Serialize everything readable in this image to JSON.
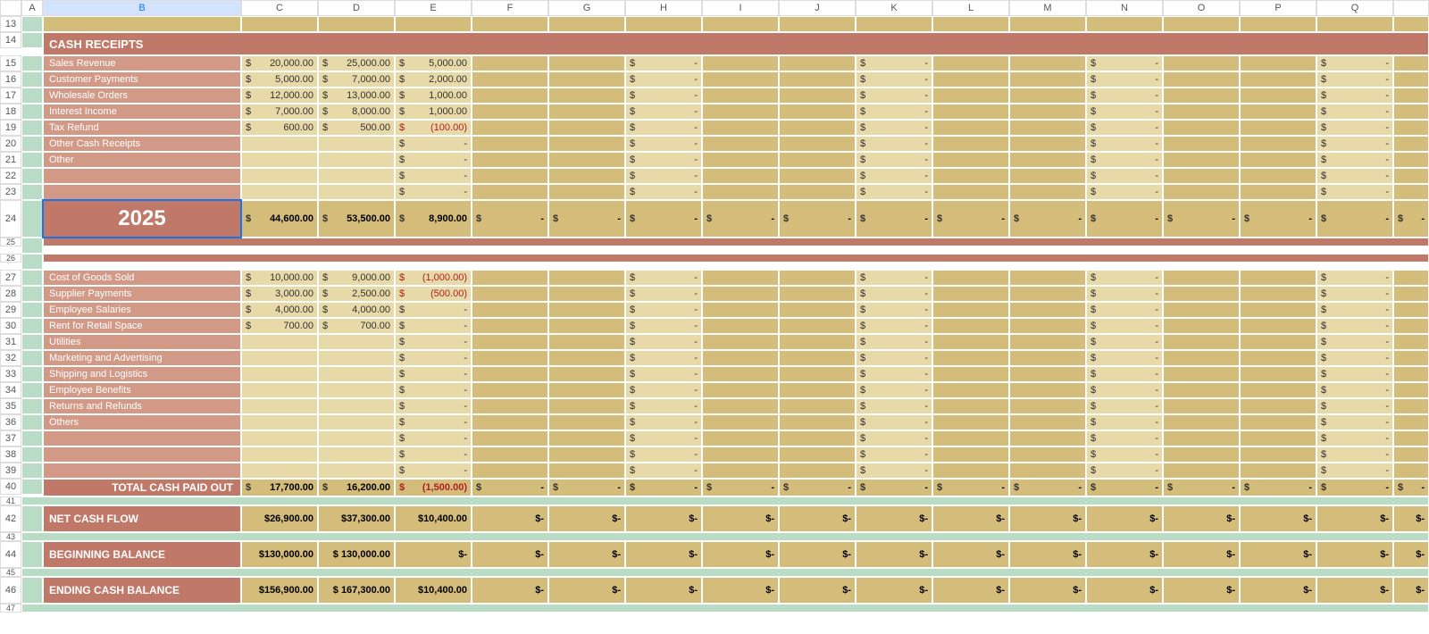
{
  "columns": [
    "",
    "A",
    "B",
    "C",
    "D",
    "E",
    "F",
    "G",
    "H",
    "I",
    "J",
    "K",
    "L",
    "M",
    "N",
    "O",
    "P",
    "Q",
    ""
  ],
  "selected_col": "B",
  "editing_cell_ref": "B11",
  "editing_value": "2025",
  "row_numbers_start": 13,
  "sections": {
    "receipts": {
      "title": "CASH RECEIPTS",
      "rows": [
        {
          "label": "Sales Revenue",
          "vals": [
            "20,000.00",
            "25,000.00",
            "5,000.00"
          ]
        },
        {
          "label": "Customer Payments",
          "vals": [
            "5,000.00",
            "7,000.00",
            "2,000.00"
          ]
        },
        {
          "label": "Wholesale Orders",
          "vals": [
            "12,000.00",
            "13,000.00",
            "1,000.00"
          ]
        },
        {
          "label": "Interest Income",
          "vals": [
            "7,000.00",
            "8,000.00",
            "1,000.00"
          ]
        },
        {
          "label": "Tax Refund",
          "vals": [
            "600.00",
            "500.00",
            "(100.00)"
          ]
        },
        {
          "label": "Other Cash Receipts",
          "vals": [
            "",
            "",
            "-"
          ]
        },
        {
          "label": "Other",
          "vals": [
            "",
            "",
            "-"
          ]
        },
        {
          "label": "",
          "vals": [
            "",
            "",
            "-"
          ]
        },
        {
          "label": "",
          "vals": [
            "",
            "",
            "-"
          ]
        }
      ],
      "total_vals": [
        "44,600.00",
        "53,500.00",
        "8,900.00"
      ]
    },
    "paidout": {
      "rows": [
        {
          "label": "Cost of Goods Sold",
          "vals": [
            "10,000.00",
            "9,000.00",
            "(1,000.00)"
          ]
        },
        {
          "label": "Supplier Payments",
          "vals": [
            "3,000.00",
            "2,500.00",
            "(500.00)"
          ]
        },
        {
          "label": "Employee Salaries",
          "vals": [
            "4,000.00",
            "4,000.00",
            "-"
          ]
        },
        {
          "label": "Rent for Retail Space",
          "vals": [
            "700.00",
            "700.00",
            "-"
          ]
        },
        {
          "label": "Utilities",
          "vals": [
            "",
            "",
            "-"
          ]
        },
        {
          "label": "Marketing and Advertising",
          "vals": [
            "",
            "",
            "-"
          ]
        },
        {
          "label": "Shipping and Logistics",
          "vals": [
            "",
            "",
            "-"
          ]
        },
        {
          "label": "Employee Benefits",
          "vals": [
            "",
            "",
            "-"
          ]
        },
        {
          "label": "Returns and Refunds",
          "vals": [
            "",
            "",
            "-"
          ]
        },
        {
          "label": "Others",
          "vals": [
            "",
            "",
            "-"
          ]
        },
        {
          "label": "",
          "vals": [
            "",
            "",
            "-"
          ]
        },
        {
          "label": "",
          "vals": [
            "",
            "",
            "-"
          ]
        },
        {
          "label": "",
          "vals": [
            "",
            "",
            "-"
          ]
        }
      ],
      "total_label": "TOTAL CASH PAID OUT",
      "total_vals": [
        "17,700.00",
        "16,200.00",
        "(1,500.00)"
      ]
    },
    "summary": [
      {
        "label": "NET CASH FLOW",
        "vals": [
          "26,900.00",
          "37,300.00",
          "10,400.00"
        ]
      },
      {
        "label": "BEGINNING BALANCE",
        "vals": [
          "130,000.00",
          "$ 130,000.00",
          "-"
        ]
      },
      {
        "label": "ENDING CASH BALANCE",
        "vals": [
          "156,900.00",
          "$ 167,300.00",
          "10,400.00"
        ]
      }
    ]
  },
  "dash_cols_line": [
    "H",
    "K",
    "N",
    "Q"
  ],
  "dash_cols_total": [
    "F",
    "G",
    "H",
    "I",
    "J",
    "K",
    "L",
    "M",
    "N",
    "O",
    "P",
    "Q",
    ""
  ]
}
